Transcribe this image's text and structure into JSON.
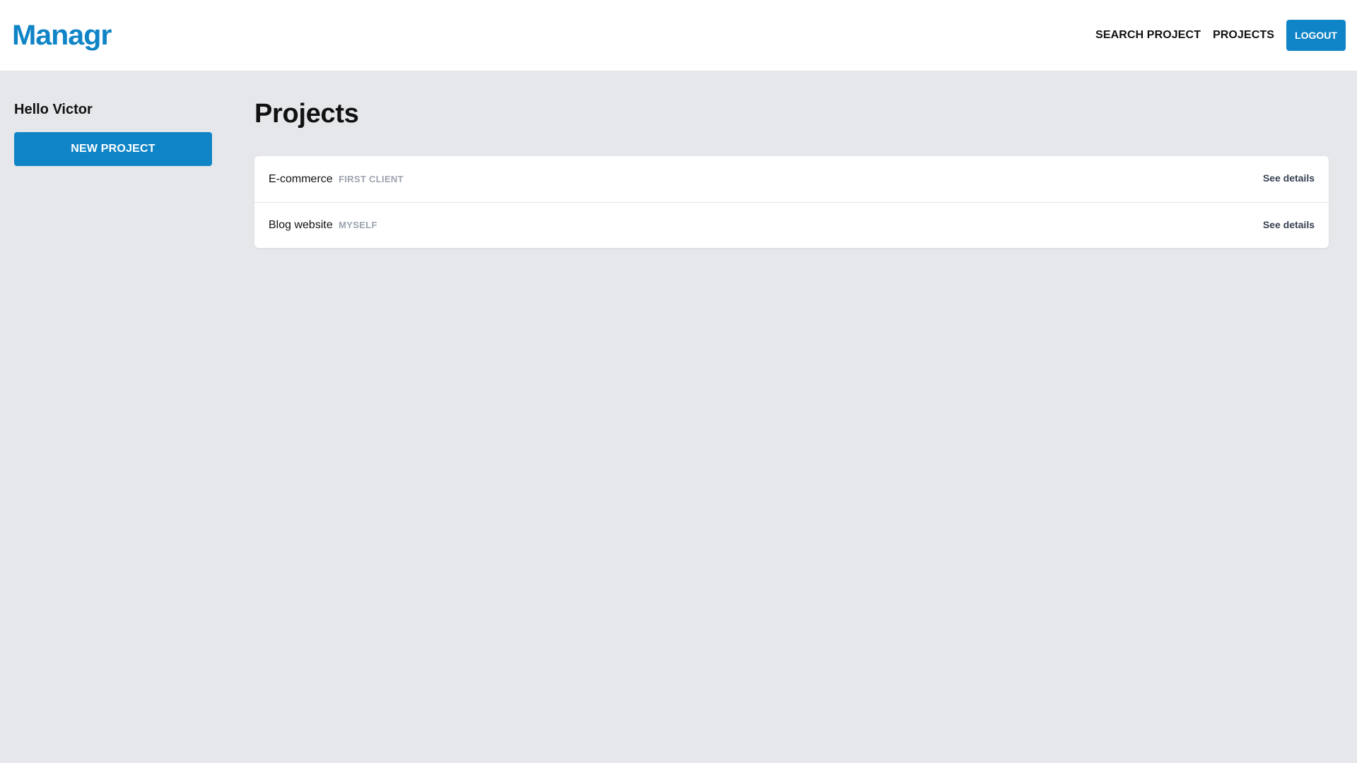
{
  "header": {
    "logo": "Managr",
    "nav": [
      {
        "label": "SEARCH PROJECT"
      },
      {
        "label": "PROJECTS"
      }
    ],
    "logout_label": "LOGOUT"
  },
  "sidebar": {
    "greeting": "Hello Victor",
    "new_project_label": "NEW PROJECT"
  },
  "main": {
    "title": "Projects",
    "projects": [
      {
        "name": "E-commerce",
        "client": "FIRST CLIENT",
        "action": "See details"
      },
      {
        "name": "Blog website",
        "client": "MYSELF",
        "action": "See details"
      }
    ]
  },
  "colors": {
    "accent": "#0f84c6",
    "background": "#e5e7eb",
    "muted_text": "#9ca3af"
  }
}
